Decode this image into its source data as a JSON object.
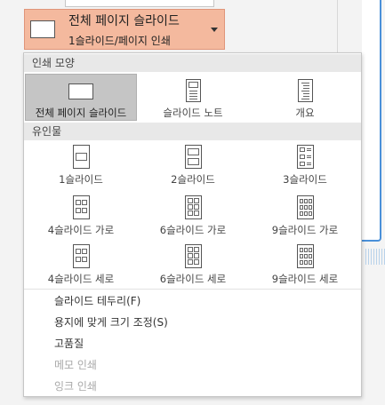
{
  "layout_button": {
    "title": "전체 페이지 슬라이드",
    "subtitle": "1슬라이드/페이지 인쇄"
  },
  "print_layout": {
    "header": "인쇄 모양",
    "items": [
      "전체 페이지 슬라이드",
      "슬라이드 노트",
      "개요"
    ],
    "selected": "전체 페이지 슬라이드"
  },
  "handouts": {
    "header": "유인물",
    "items": [
      "1슬라이드",
      "2슬라이드",
      "3슬라이드",
      "4슬라이드 가로",
      "6슬라이드 가로",
      "9슬라이드 가로",
      "4슬라이드 세로",
      "6슬라이드 세로",
      "9슬라이드 세로"
    ]
  },
  "options": [
    {
      "label": "슬라이드 테두리(F)",
      "enabled": true
    },
    {
      "label": "용지에 맞게 크기 조정(S)",
      "enabled": true
    },
    {
      "label": "고품질",
      "enabled": true
    },
    {
      "label": "메모 인쇄",
      "enabled": false
    },
    {
      "label": "잉크 인쇄",
      "enabled": false
    }
  ]
}
